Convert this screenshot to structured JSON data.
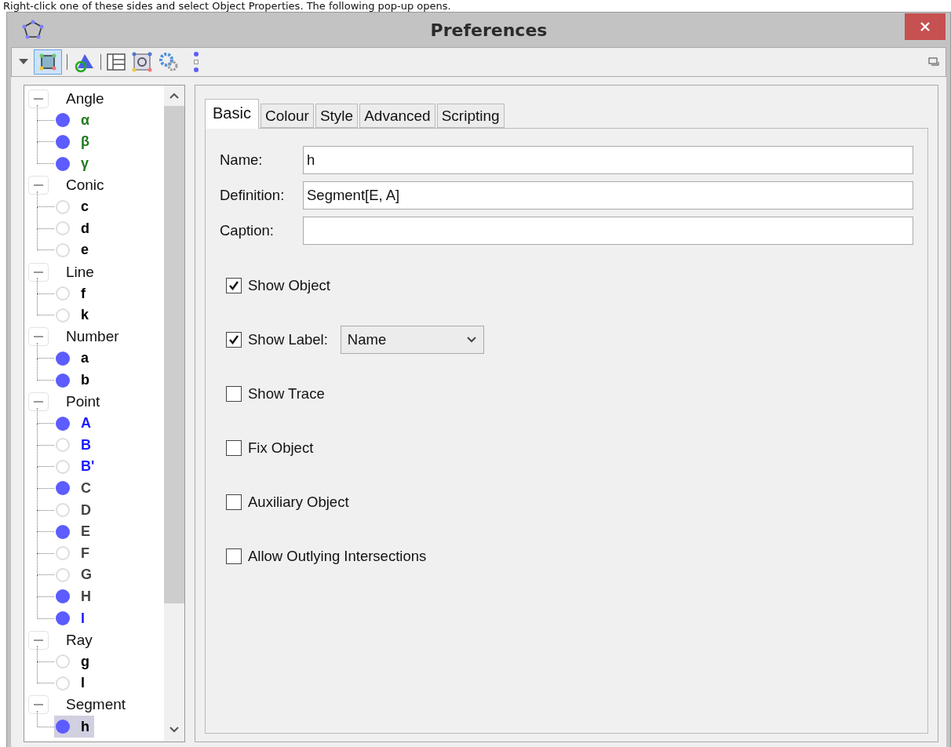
{
  "caption_text": "Right-click one of these sides and select Object Properties. The following pop-up opens.",
  "window": {
    "title": "Preferences"
  },
  "tree": [
    {
      "label": "Angle",
      "expanded": true,
      "children": [
        {
          "label": "α",
          "visible": true,
          "selected": false,
          "color": "#1e7a1e"
        },
        {
          "label": "β",
          "visible": true,
          "selected": false,
          "color": "#1e7a1e"
        },
        {
          "label": "γ",
          "visible": true,
          "selected": false,
          "color": "#1e7a1e"
        }
      ]
    },
    {
      "label": "Conic",
      "expanded": true,
      "children": [
        {
          "label": "c",
          "visible": false,
          "selected": false,
          "color": "#000000"
        },
        {
          "label": "d",
          "visible": false,
          "selected": false,
          "color": "#000000"
        },
        {
          "label": "e",
          "visible": false,
          "selected": false,
          "color": "#000000"
        }
      ]
    },
    {
      "label": "Line",
      "expanded": true,
      "children": [
        {
          "label": "f",
          "visible": false,
          "selected": false,
          "color": "#000000"
        },
        {
          "label": "k",
          "visible": false,
          "selected": false,
          "color": "#000000"
        }
      ]
    },
    {
      "label": "Number",
      "expanded": true,
      "children": [
        {
          "label": "a",
          "visible": true,
          "selected": false,
          "color": "#000000"
        },
        {
          "label": "b",
          "visible": true,
          "selected": false,
          "color": "#000000"
        }
      ]
    },
    {
      "label": "Point",
      "expanded": true,
      "children": [
        {
          "label": "A",
          "visible": true,
          "selected": false,
          "color": "#1a1aff"
        },
        {
          "label": "B",
          "visible": false,
          "selected": false,
          "color": "#1a1aff"
        },
        {
          "label": "B'",
          "visible": false,
          "selected": false,
          "color": "#1a1aff"
        },
        {
          "label": "C",
          "visible": true,
          "selected": false,
          "color": "#444444"
        },
        {
          "label": "D",
          "visible": false,
          "selected": false,
          "color": "#444444"
        },
        {
          "label": "E",
          "visible": true,
          "selected": false,
          "color": "#444444"
        },
        {
          "label": "F",
          "visible": false,
          "selected": false,
          "color": "#444444"
        },
        {
          "label": "G",
          "visible": false,
          "selected": false,
          "color": "#444444"
        },
        {
          "label": "H",
          "visible": true,
          "selected": false,
          "color": "#444444"
        },
        {
          "label": "I",
          "visible": true,
          "selected": false,
          "color": "#1a1aff"
        }
      ]
    },
    {
      "label": "Ray",
      "expanded": true,
      "children": [
        {
          "label": "g",
          "visible": false,
          "selected": false,
          "color": "#000000"
        },
        {
          "label": "l",
          "visible": false,
          "selected": false,
          "color": "#000000"
        }
      ]
    },
    {
      "label": "Segment",
      "expanded": true,
      "children": [
        {
          "label": "h",
          "visible": true,
          "selected": true,
          "color": "#000000"
        }
      ]
    }
  ],
  "tabs": [
    {
      "label": "Basic",
      "selected": true
    },
    {
      "label": "Colour",
      "selected": false
    },
    {
      "label": "Style",
      "selected": false
    },
    {
      "label": "Advanced",
      "selected": false
    },
    {
      "label": "Scripting",
      "selected": false
    }
  ],
  "fields": [
    {
      "label": "Name:",
      "value": "h"
    },
    {
      "label": "Definition:",
      "value": "Segment[E, A]"
    },
    {
      "label": "Caption:"
    }
  ],
  "options": [
    {
      "label": "Show Object",
      "checked": true
    },
    {
      "label": "Show Label:",
      "checked": true,
      "dropdown": "Name"
    },
    {
      "label": "Show Trace",
      "checked": false
    },
    {
      "label": "Fix Object",
      "checked": false
    },
    {
      "label": "Auxiliary Object",
      "checked": false
    },
    {
      "label": "Allow Outlying Intersections",
      "checked": false
    }
  ]
}
